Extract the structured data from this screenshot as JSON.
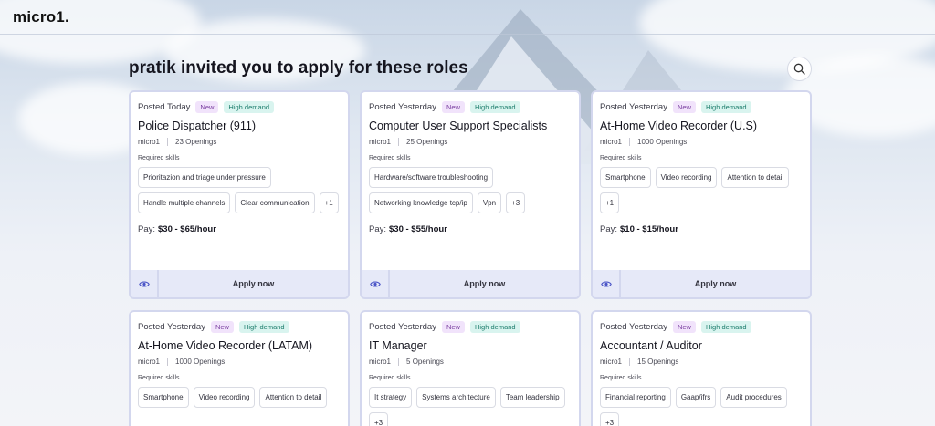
{
  "app": {
    "logo": "micro1."
  },
  "page": {
    "heading": "pratik invited you to apply for these roles"
  },
  "labels": {
    "required_skills": "Required skills",
    "pay_label": "Pay:",
    "apply": "Apply now"
  },
  "colors": {
    "card_border": "#d3d7ee",
    "new_badge_bg": "#f1e3fb",
    "high_demand_bg": "#d9f4ef"
  },
  "icons": {
    "search": "search-icon",
    "view": "eye-icon"
  },
  "cards": [
    {
      "posted": "Posted Today",
      "badge_new": "New",
      "badge_demand": "High demand",
      "title": "Police Dispatcher (911)",
      "company": "micro1",
      "openings": "23 Openings",
      "skills": [
        "Prioritazion and triage under pressure",
        "Handle multiple channels",
        "Clear communication",
        "+1"
      ],
      "pay": "$30 - $65/hour"
    },
    {
      "posted": "Posted Yesterday",
      "badge_new": "New",
      "badge_demand": "High demand",
      "title": "Computer User Support Specialists",
      "company": "micro1",
      "openings": "25 Openings",
      "skills": [
        "Hardware/software troubleshooting",
        "Networking knowledge tcp/ip",
        "Vpn",
        "+3"
      ],
      "pay": "$30 - $55/hour"
    },
    {
      "posted": "Posted Yesterday",
      "badge_new": "New",
      "badge_demand": "High demand",
      "title": "At-Home Video Recorder (U.S)",
      "company": "micro1",
      "openings": "1000 Openings",
      "skills": [
        "Smartphone",
        "Video recording",
        "Attention to detail",
        "+1"
      ],
      "pay": "$10 - $15/hour"
    },
    {
      "posted": "Posted Yesterday",
      "badge_new": "New",
      "badge_demand": "High demand",
      "title": "At-Home Video Recorder (LATAM)",
      "company": "micro1",
      "openings": "1000 Openings",
      "skills": [
        "Smartphone",
        "Video recording",
        "Attention to detail"
      ],
      "pay": ""
    },
    {
      "posted": "Posted Yesterday",
      "badge_new": "New",
      "badge_demand": "High demand",
      "title": "IT Manager",
      "company": "micro1",
      "openings": "5 Openings",
      "skills": [
        "It strategy",
        "Systems architecture",
        "Team leadership",
        "+3"
      ],
      "pay": ""
    },
    {
      "posted": "Posted Yesterday",
      "badge_new": "New",
      "badge_demand": "High demand",
      "title": "Accountant / Auditor",
      "company": "micro1",
      "openings": "15 Openings",
      "skills": [
        "Financial reporting",
        "Gaap/ifrs",
        "Audit procedures",
        "+3"
      ],
      "pay": ""
    }
  ]
}
